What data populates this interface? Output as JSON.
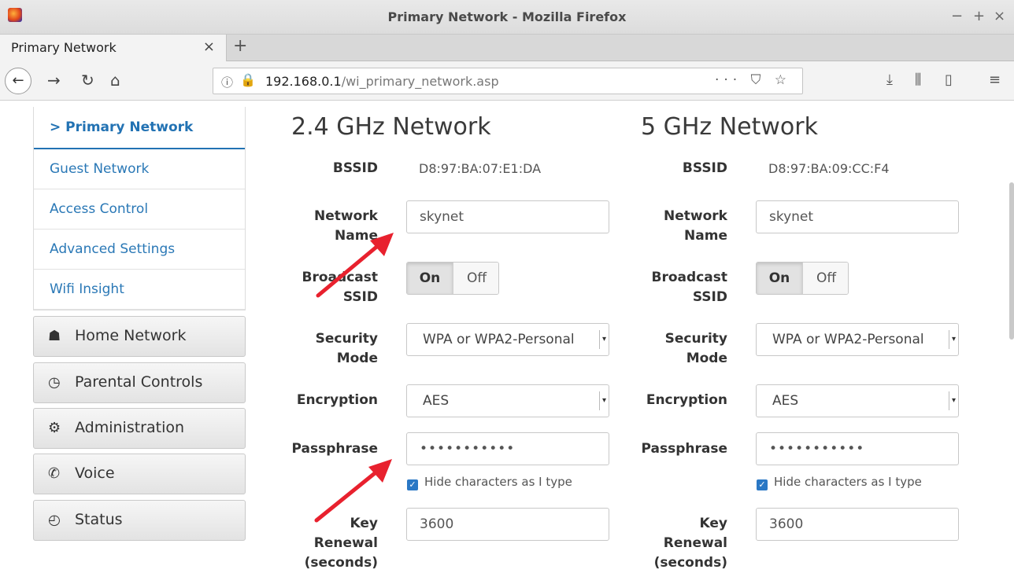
{
  "window": {
    "title": "Primary Network - Mozilla Firefox",
    "controls": [
      "−",
      "+",
      "×"
    ]
  },
  "tab": {
    "label": "Primary Network",
    "close": "×",
    "new_tab": "+"
  },
  "nav": {
    "url_host": "192.168.0.1",
    "url_path": "/wi_primary_network.asp",
    "page_actions": "··· ⛉ ☆"
  },
  "sidebar": {
    "items": [
      {
        "label": "> Primary Network"
      },
      {
        "label": "Guest Network"
      },
      {
        "label": "Access Control"
      },
      {
        "label": "Advanced Settings"
      },
      {
        "label": "Wifi Insight"
      }
    ],
    "buttons": [
      {
        "label": "Home Network",
        "icon": "home-icon"
      },
      {
        "label": "Parental Controls",
        "icon": "clock-icon"
      },
      {
        "label": "Administration",
        "icon": "gear-icon"
      },
      {
        "label": "Voice",
        "icon": "phone-icon"
      },
      {
        "label": "Status",
        "icon": "gauge-icon"
      }
    ]
  },
  "labels": {
    "bssid": "BSSID",
    "network_name_1": "Network",
    "network_name_2": "Name",
    "broadcast_1": "Broadcast",
    "broadcast_2": "SSID",
    "security_1": "Security",
    "security_2": "Mode",
    "encryption": "Encryption",
    "passphrase": "Passphrase",
    "key_1": "Key",
    "key_2": "Renewal",
    "key_3": "(seconds)",
    "on": "On",
    "off": "Off",
    "hide_chars": "Hide characters as I type"
  },
  "net24": {
    "title": "2.4 GHz Network",
    "bssid": "D8:97:BA:07:E1:DA",
    "network_name": "skynet",
    "security_mode": "WPA or WPA2-Personal",
    "encryption": "AES",
    "passphrase": "•••••••••••",
    "key_renewal": "3600"
  },
  "net5": {
    "title": "5 GHz Network",
    "bssid": "D8:97:BA:09:CC:F4",
    "network_name": "skynet",
    "security_mode": "WPA or WPA2-Personal",
    "encryption": "AES",
    "passphrase": "•••••••••••",
    "key_renewal": "3600"
  },
  "colors": {
    "link": "#2a78b6",
    "annotation_arrow": "#e8212e",
    "checkbox": "#2a78c5"
  }
}
